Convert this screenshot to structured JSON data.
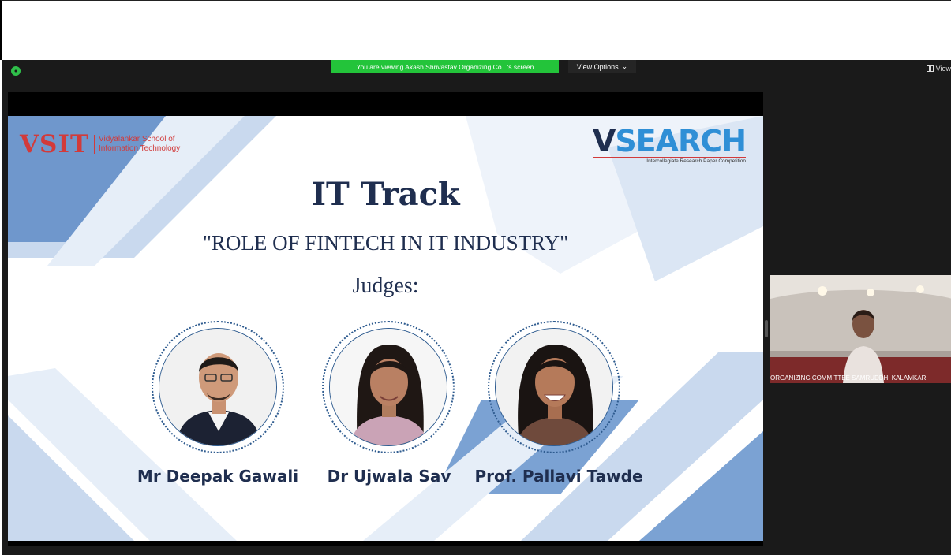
{
  "banner": {
    "share_text": "You are viewing Akash Shrivastav Organizing Co...'s screen",
    "view_options": "View Options",
    "view_top_right": "View"
  },
  "slide": {
    "vsit_logo": "VSIT",
    "vsit_name": "Vidyalankar School of Information Technology",
    "vsearch_v": "V",
    "vsearch_rest": "SEARCH",
    "vsearch_sub": "Intercollegiate Research Paper Competition",
    "title": "IT Track",
    "subtitle": "\"ROLE OF FINTECH IN IT INDUSTRY\"",
    "judges_heading": "Judges:",
    "judges": [
      {
        "name": "Mr Deepak Gawali"
      },
      {
        "name": "Dr Ujwala Sav"
      },
      {
        "name": "Prof. Pallavi Tawde"
      }
    ]
  },
  "participant": {
    "label": "ORGANIZING COMMITTEE SAMRUDDHI KALAMKAR"
  },
  "colors": {
    "banner_green": "#23c43a",
    "vsit_red": "#d23a3a",
    "navy": "#1f2e4f",
    "vsearch_blue": "#2f8fd6"
  }
}
